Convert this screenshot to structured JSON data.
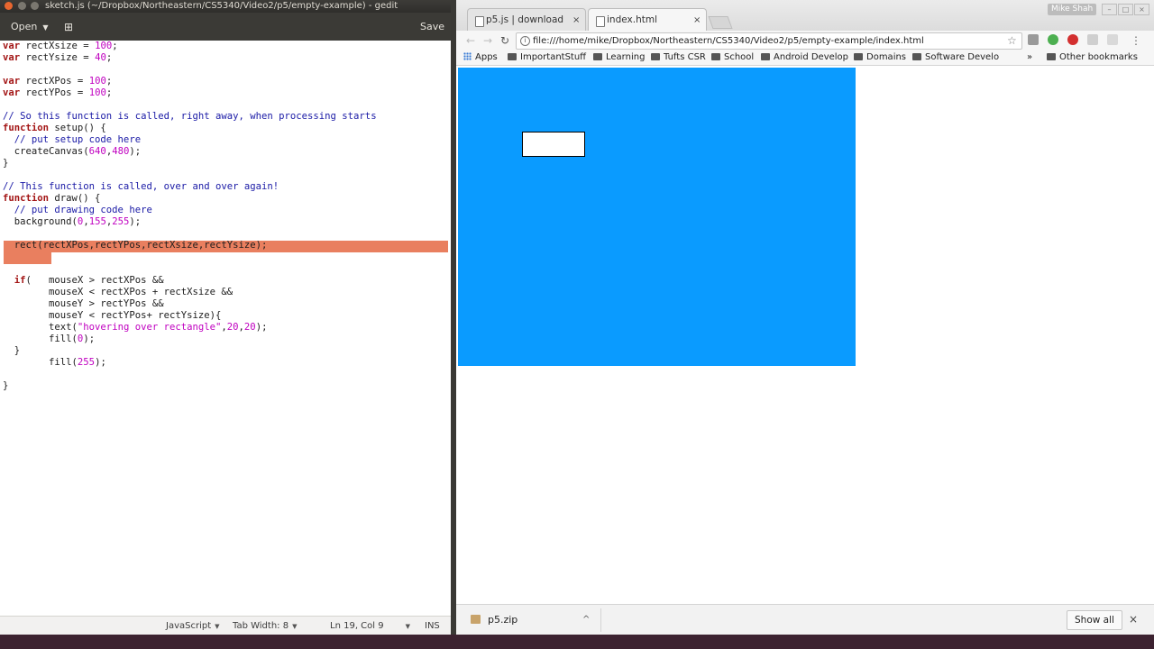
{
  "gedit": {
    "title": "sketch.js (~/Dropbox/Northeastern/CS5340/Video2/p5/empty-example) - gedit",
    "open_label": "Open",
    "save_label": "Save",
    "code_lines": [
      "var rectXsize = 100;",
      "var rectYsize = 40;",
      "",
      "var rectXPos = 100;",
      "var rectYPos = 100;",
      "",
      "// So this function is called, right away, when processing starts",
      "function setup() {",
      "  // put setup code here",
      "  createCanvas(640,480);",
      "}",
      "",
      "// This function is called, over and over again!",
      "function draw() {",
      "  // put drawing code here",
      "  background(0,155,255);",
      "",
      "  rect(rectXPos,rectYPos,rectXsize,rectYsize);",
      "",
      "",
      "  if(   mouseX > rectXPos &&",
      "        mouseX < rectXPos + rectXsize &&",
      "        mouseY > rectYPos &&",
      "        mouseY < rectYPos+ rectYsize){",
      "        text(\"hovering over rectangle\",20,20);",
      "        fill(0);",
      "  }",
      "        fill(255);",
      "",
      "}"
    ],
    "status": {
      "language": "JavaScript",
      "tab_width": "Tab Width: 8",
      "position": "Ln 19, Col 9",
      "mode": "INS"
    }
  },
  "chrome": {
    "tabs": [
      {
        "label": "p5.js | download"
      },
      {
        "label": "index.html"
      }
    ],
    "profile_name": "Mike Shah",
    "url": "file:///home/mike/Dropbox/Northeastern/CS5340/Video2/p5/empty-example/index.html",
    "bookmarks": [
      "Apps",
      "ImportantStuff",
      "Learning",
      "Tufts CSR",
      "School",
      "Android Develop",
      "Domains",
      "Software Develo"
    ],
    "more_bookmarks_symbol": "»",
    "other_bookmarks": "Other bookmarks",
    "canvas_background": "#0a9bff",
    "download": {
      "filename": "p5.zip",
      "show_all": "Show all"
    }
  },
  "icons": {
    "close": "×",
    "star": "☆",
    "reload": "↻",
    "back": "←",
    "forward": "→",
    "menu": "⋮",
    "info": "i",
    "chevron_up": "^",
    "dropdown": "▼"
  }
}
